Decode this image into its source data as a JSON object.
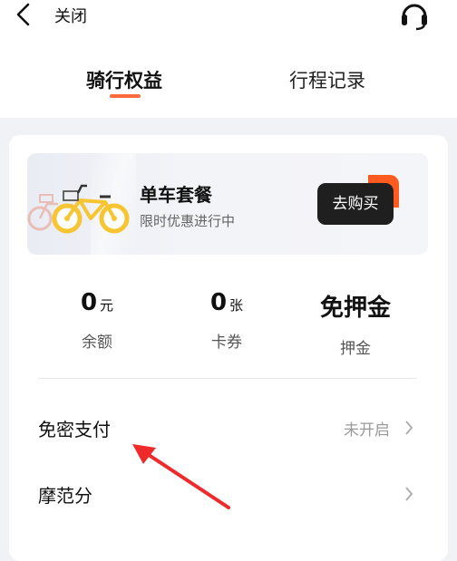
{
  "header": {
    "close_label": "关闭"
  },
  "tabs": [
    {
      "label": "骑行权益",
      "active": true
    },
    {
      "label": "行程记录",
      "active": false
    }
  ],
  "banner": {
    "title": "单车套餐",
    "subtitle": "限时优惠进行中",
    "button_label": "去购买"
  },
  "stats": [
    {
      "value": "0",
      "unit": "元",
      "label": "余额"
    },
    {
      "value": "0",
      "unit": "张",
      "label": "卡券"
    },
    {
      "value": "免押金",
      "unit": "",
      "label": "押金"
    }
  ],
  "rows": [
    {
      "title": "免密支付",
      "status": "未开启"
    },
    {
      "title": "摩范分",
      "status": ""
    }
  ],
  "colors": {
    "accent": "#ff6a3d",
    "annotation_arrow": "#ee2a2a",
    "bike_yellow": "#f6c531"
  }
}
